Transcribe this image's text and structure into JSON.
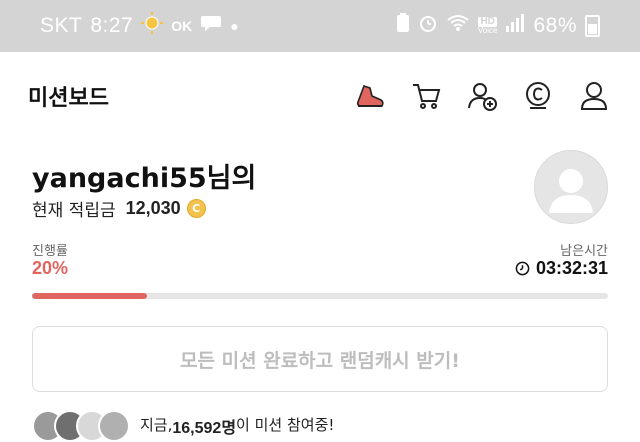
{
  "status_bar": {
    "carrier": "SKT",
    "time": "8:27",
    "network_icon_text": "OK",
    "hd_label": "HD",
    "voice_label": "Voice",
    "battery": "68%"
  },
  "header": {
    "title": "미션보드",
    "icons": [
      "sneaker-icon",
      "cart-icon",
      "add-friend-icon",
      "coin-icon",
      "profile-icon"
    ]
  },
  "profile": {
    "greeting": "yangachi55님의",
    "points_label": "현재 적립금",
    "points_value": "12,030",
    "coin_symbol": "C"
  },
  "progress": {
    "label": "진행률",
    "value_text": "20%",
    "fraction": 0.2,
    "remaining_label": "남은시간",
    "remaining_time": "03:32:31"
  },
  "cta": {
    "label": "모든 미션 완료하고 랜덤캐시 받기!"
  },
  "participants": {
    "prefix": "지금, ",
    "count": "16,592명",
    "suffix": "이 미션 참여중!"
  },
  "colors": {
    "accent": "#e0655f",
    "status_bar_bg": "#d4d4d4",
    "coin": "#f2c14e"
  }
}
